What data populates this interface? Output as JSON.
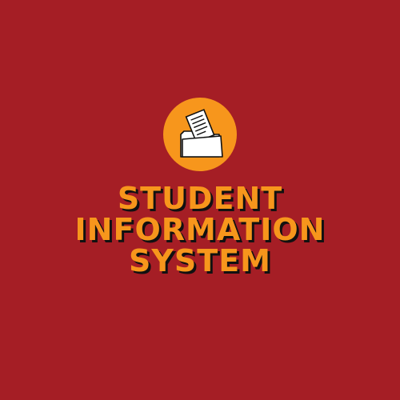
{
  "logo": {
    "icon": "folder-with-document-icon",
    "circle_color": "#f7961c"
  },
  "title": {
    "lines": [
      "STUDENT",
      "INFORMATION",
      "SYSTEM"
    ],
    "color": "#f7961c",
    "shadow_color": "#111111"
  },
  "background_color": "#a51e25"
}
